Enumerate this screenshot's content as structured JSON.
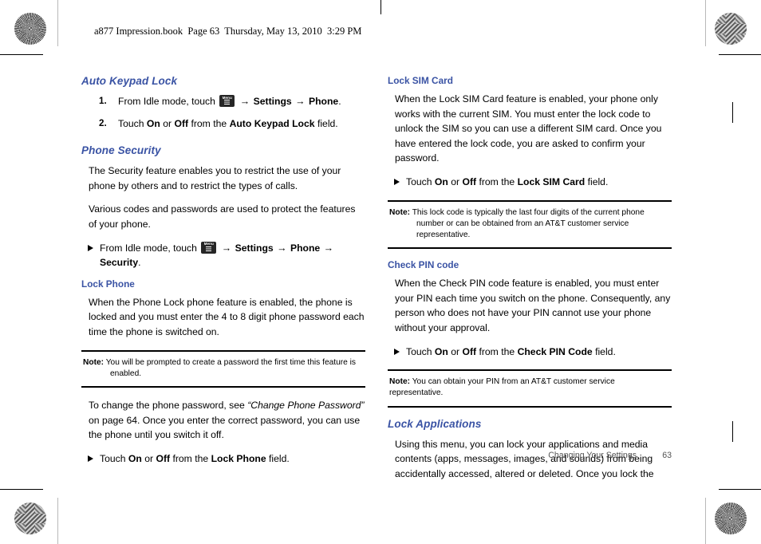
{
  "page": {
    "header": "a877 Impression.book  Page 63  Thursday, May 13, 2010  3:29 PM",
    "footer_chapter": "Changing Your Settings",
    "footer_page_number": "63",
    "heading_color": "#3a53a4",
    "text_color": "#000000"
  },
  "menu_key": {
    "label": "Menu",
    "icon": "menu-grid-icon"
  },
  "arrow_glyph": "→",
  "left_column": {
    "auto_keypad_lock": {
      "heading": "Auto Keypad Lock",
      "steps": [
        {
          "num": "1.",
          "pre": "From Idle mode, touch ",
          "after_icon_1": " ",
          "nav_1": "Settings",
          "nav_2": "Phone",
          "end": "."
        },
        {
          "num": "2.",
          "pre": "Touch ",
          "on": "On",
          "mid": " or ",
          "off": "Off",
          "post": " from the ",
          "field": "Auto Keypad Lock",
          "end": " field."
        }
      ]
    },
    "phone_security": {
      "heading": "Phone Security",
      "para1": "The Security feature enables you to restrict the use of your phone by others and to restrict the types of calls.",
      "para2": "Various codes and passwords are used to protect the features of your phone.",
      "bullet": {
        "pre": "From Idle mode, touch ",
        "nav_1": "Settings",
        "nav_2": "Phone",
        "nav_3": "Security",
        "end": "."
      }
    },
    "lock_phone": {
      "heading": "Lock Phone",
      "para1": "When the Phone Lock phone feature is enabled, the phone is locked and you must enter the 4 to 8 digit phone password each time the phone is switched on.",
      "note": {
        "label": "Note:",
        "text": "You will be prompted to create a password the first time this feature is enabled."
      },
      "para2_pre": "To change the phone password, see ",
      "para2_ref": "“Change Phone Password”",
      "para2_post": " on page 64. Once you enter the correct password, you can use the phone until you switch it off.",
      "bullet": {
        "pre": "Touch ",
        "on": "On",
        "mid": " or ",
        "off": "Off",
        "post": " from the ",
        "field": "Lock Phone",
        "end": " field."
      }
    }
  },
  "right_column": {
    "lock_sim_card": {
      "heading": "Lock SIM Card",
      "para1": "When the Lock SIM Card feature is enabled, your phone only works with the current SIM. You must enter the lock code to unlock the SIM so you can use a different SIM card. Once you have entered the lock code, you are asked to confirm your password.",
      "bullet": {
        "pre": "Touch ",
        "on": "On",
        "mid": " or ",
        "off": "Off",
        "post": " from the ",
        "field": "Lock SIM Card",
        "end": " field."
      },
      "note": {
        "label": "Note:",
        "text": "This lock code is typically the last four digits of the current phone number or can be obtained from an AT&T customer service representative."
      }
    },
    "check_pin_code": {
      "heading": "Check PIN code",
      "para1": "When the Check PIN code feature is enabled, you must enter your PIN each time you switch on the phone. Consequently, any person who does not have your PIN cannot use your phone without your approval.",
      "bullet": {
        "pre": "Touch ",
        "on": "On",
        "mid": " or ",
        "off": "Off",
        "post": " from the ",
        "field": "Check PIN Code",
        "end": " field."
      },
      "note": {
        "label": "Note:",
        "text": "You can obtain your PIN from an AT&T customer service representative."
      }
    },
    "lock_applications": {
      "heading": "Lock Applications",
      "para1": "Using this menu, you can lock your applications and media contents (apps, messages, images, and sounds) from being accidentally accessed, altered or deleted. Once you lock the"
    }
  }
}
